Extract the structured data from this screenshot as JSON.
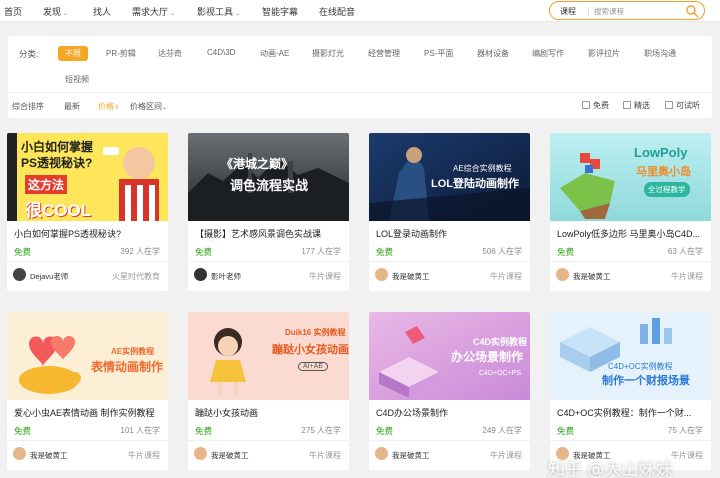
{
  "nav": {
    "items": [
      {
        "label": "首页",
        "chevron": false
      },
      {
        "label": "发现",
        "chevron": true
      },
      {
        "label": "找人",
        "chevron": false
      },
      {
        "label": "需求大厅",
        "chevron": true
      },
      {
        "label": "影视工具",
        "chevron": true
      },
      {
        "label": "智能字幕",
        "chevron": false
      },
      {
        "label": "在线配音",
        "chevron": false
      }
    ],
    "search": {
      "category": "课程",
      "placeholder": "搜索课程",
      "icon": "search-icon"
    }
  },
  "filters": {
    "category_label": "分类:",
    "tags": [
      "不限",
      "PR-剪辑",
      "达芬奇",
      "C4D\\3D",
      "动画-AE",
      "摄影灯光",
      "经营管理",
      "PS-平面",
      "器材设备",
      "编剧写作",
      "影评拉片",
      "职场沟通",
      "短视频"
    ],
    "active_tag": "不限",
    "sort": [
      {
        "label": "综合排序",
        "arrow": ""
      },
      {
        "label": "最新",
        "arrow": ""
      },
      {
        "label": "价格",
        "arrow": "⇕"
      },
      {
        "label": "价格区间",
        "arrow": "⌄"
      }
    ],
    "active_sort": "价格",
    "checks": [
      "免费",
      "精选",
      "可试听"
    ]
  },
  "cards": [
    {
      "title": "小白如何掌握PS透视秘诀?",
      "price": "免费",
      "learners": "392 人在学",
      "teacher": "Dejavu老师",
      "institution": "火星时代教育",
      "thumb_lines": [
        "小白如何掌握",
        "PS透视秘诀?",
        "这方法",
        "很COOL"
      ]
    },
    {
      "title": "【摄影】艺术感风景调色实战课",
      "price": "免费",
      "learners": "177 人在学",
      "teacher": "影叶老师",
      "institution": "牛片课程",
      "thumb_lines": [
        "《港城之巅》",
        "调色流程实战"
      ]
    },
    {
      "title": "LOL登录动画制作",
      "price": "免费",
      "learners": "506 人在学",
      "teacher": "我是破黄工",
      "institution": "牛片课程",
      "thumb_lines": [
        "AE综合实例教程",
        "LOL登陆动画制作"
      ]
    },
    {
      "title": "LowPoly低多边形 马里奥小岛C4D...",
      "price": "免费",
      "learners": "63 人在学",
      "teacher": "我是破黄工",
      "institution": "牛片课程",
      "thumb_lines": [
        "LowPoly",
        "马里奥小岛",
        "全过程教学"
      ]
    },
    {
      "title": "爱心小虫AE表情动画 制作实例教程",
      "price": "免费",
      "learners": "101 人在学",
      "teacher": "我是破黄工",
      "institution": "牛片课程",
      "thumb_lines": [
        "AE实例教程",
        "表情动画制作"
      ]
    },
    {
      "title": "蹦跶小女孩动画",
      "price": "免费",
      "learners": "275 人在学",
      "teacher": "我是破黄工",
      "institution": "牛片课程",
      "thumb_lines": [
        "Duik16 实例教程",
        "蹦跶小女孩动画",
        "AI+AE"
      ]
    },
    {
      "title": "C4D办公场景制作",
      "price": "免费",
      "learners": "249 人在学",
      "teacher": "我是破黄工",
      "institution": "牛片课程",
      "thumb_lines": [
        "C4D实例教程",
        "办公场景制作",
        "C4D+OC+PS"
      ]
    },
    {
      "title": "C4D+OC实例教程：制作一个财...",
      "price": "免费",
      "learners": "75 人在学",
      "teacher": "我是破黄工",
      "institution": "牛片课程",
      "thumb_lines": [
        "C4D+OC实例教程",
        "制作一个财报场景"
      ]
    }
  ],
  "watermark": "知乎 @大山妹妹",
  "colors": {
    "accent": "#f5a623",
    "free": "#2aa515",
    "background": "#f1f1f1"
  }
}
